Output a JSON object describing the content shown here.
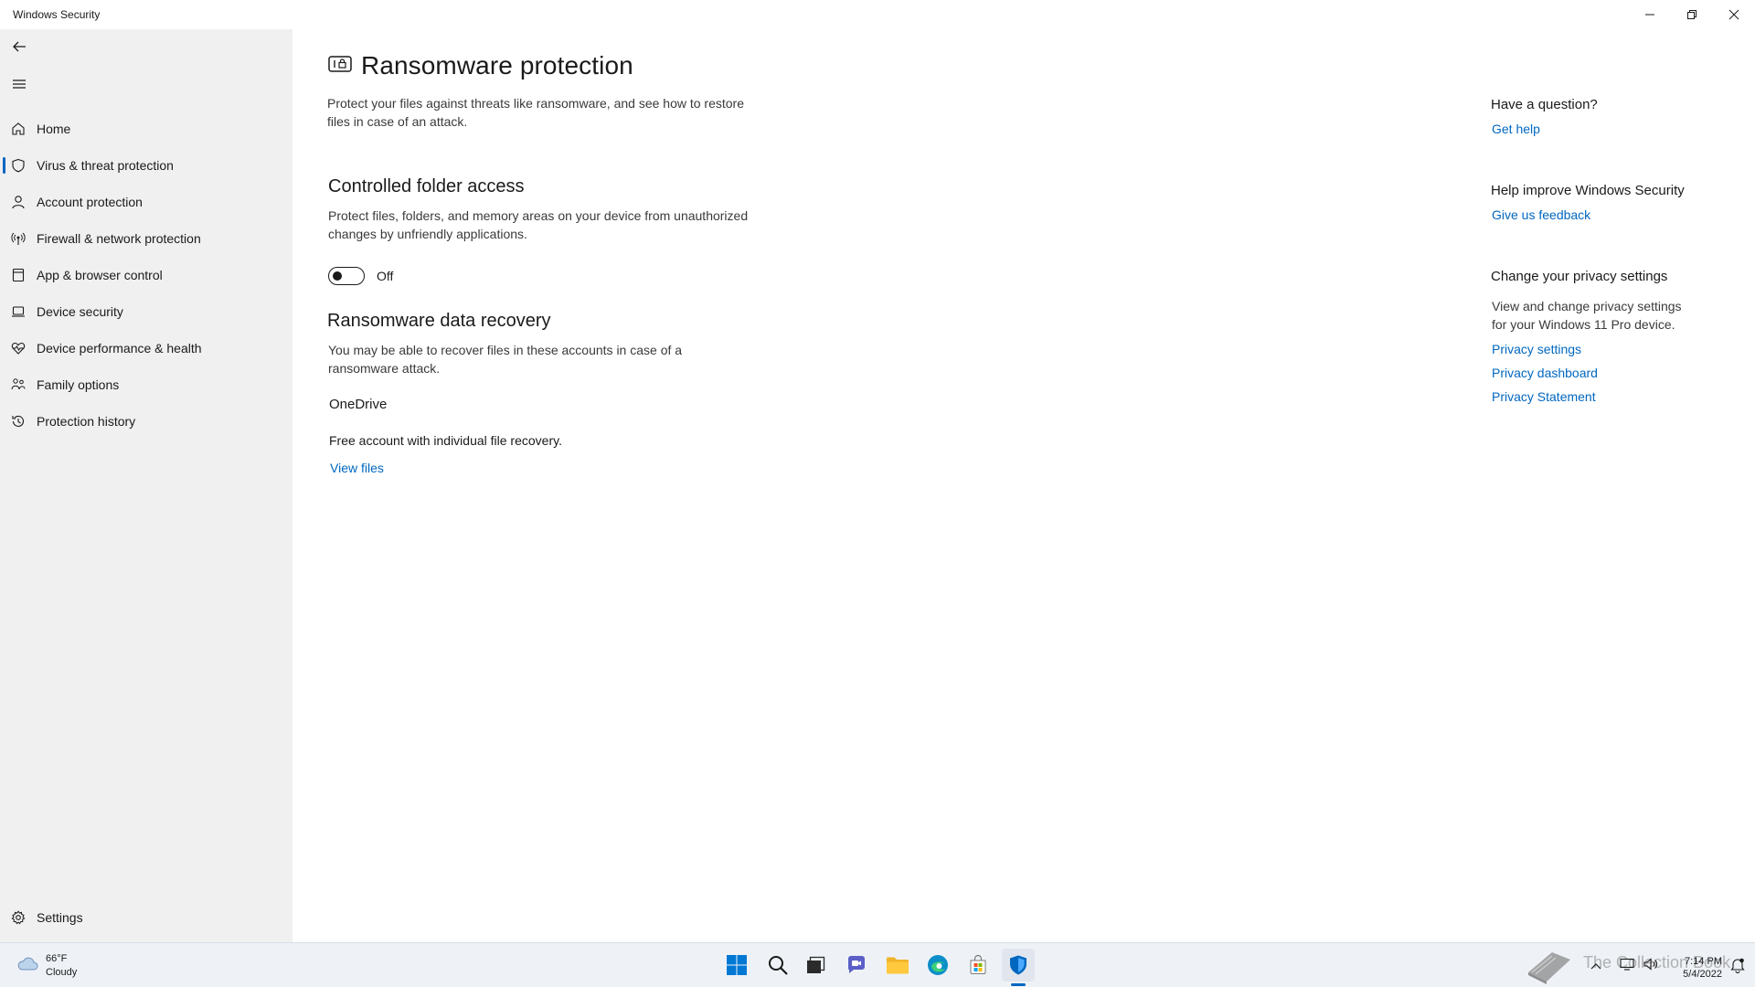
{
  "window": {
    "title": "Windows Security"
  },
  "sidebar": {
    "items": [
      {
        "label": "Home",
        "icon": "home-icon"
      },
      {
        "label": "Virus & threat protection",
        "icon": "shield-icon",
        "active": true
      },
      {
        "label": "Account protection",
        "icon": "person-icon"
      },
      {
        "label": "Firewall & network protection",
        "icon": "antenna-icon"
      },
      {
        "label": "App & browser control",
        "icon": "app-window-icon"
      },
      {
        "label": "Device security",
        "icon": "laptop-icon"
      },
      {
        "label": "Device performance & health",
        "icon": "heart-icon"
      },
      {
        "label": "Family options",
        "icon": "family-icon"
      },
      {
        "label": "Protection history",
        "icon": "history-icon"
      }
    ],
    "settings_label": "Settings"
  },
  "main": {
    "title": "Ransomware protection",
    "description_line1": "Protect your files against threats like ransomware, and see how to restore",
    "description_line2": "files in case of an attack.",
    "cfa": {
      "heading": "Controlled folder access",
      "desc_line1": "Protect files, folders, and memory areas on your device from unauthorized",
      "desc_line2": "changes by unfriendly applications.",
      "toggle_state": "Off"
    },
    "recovery": {
      "heading": "Ransomware data recovery",
      "desc_line1": "You may be able to recover files in these accounts in case of a",
      "desc_line2": "ransomware attack.",
      "provider": "OneDrive",
      "account_text": "Free account with individual file recovery.",
      "view_files_label": "View files"
    }
  },
  "right": {
    "question_heading": "Have a question?",
    "get_help": "Get help",
    "improve_heading": "Help improve Windows Security",
    "feedback": "Give us feedback",
    "privacy_heading": "Change your privacy settings",
    "privacy_line1": "View and change privacy settings",
    "privacy_line2": "for your Windows 11 Pro device.",
    "privacy_settings": "Privacy settings",
    "privacy_dashboard": "Privacy dashboard",
    "privacy_statement": "Privacy Statement"
  },
  "taskbar": {
    "weather_temp": "66°F",
    "weather_cond": "Cloudy",
    "time": "7:14 PM",
    "date": "5/4/2022",
    "watermark": "The Collection Book"
  },
  "colors": {
    "accent": "#0067c0",
    "sidebar_bg": "#f0f0f0",
    "taskbar_bg": "#eef2f7"
  }
}
